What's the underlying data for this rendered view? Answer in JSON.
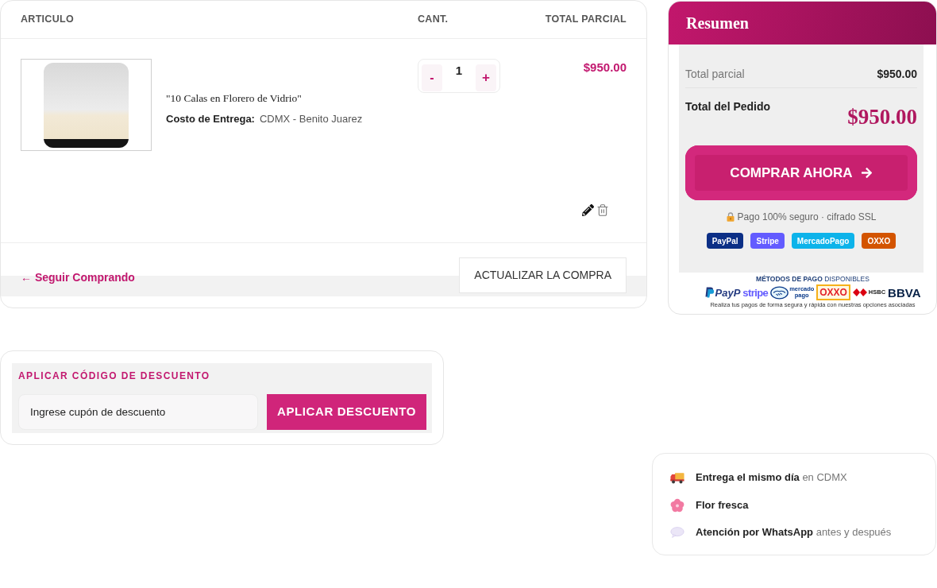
{
  "cart": {
    "columns": [
      "ARTICULO",
      "CANT.",
      "TOTAL PARCIAL"
    ],
    "items": [
      {
        "name": "\"10 Calas en Florero de Vidrio\"",
        "delivery_label": "Costo de Entrega:",
        "delivery_value": "CDMX - Benito Juarez",
        "decrement": "-",
        "quantity": "1",
        "increment": "+",
        "subtotal": "$950.00"
      }
    ],
    "continue_link": "← Seguir Comprando",
    "update_button": "ACTUALIZAR LA COMPRA"
  },
  "summary": {
    "title": "Resumen",
    "rows": [
      {
        "kind": "subtotal",
        "label": "Total parcial",
        "value": "$950.00"
      },
      {
        "kind": "total",
        "label": "Total del Pedido",
        "value": "$950.00"
      }
    ],
    "checkout_button": "COMPRAR AHORA",
    "secure_note": "Pago 100% seguro · cifrado SSL",
    "badges": [
      {
        "label": "PayPal",
        "color": "#0c2f86"
      },
      {
        "label": "Stripe",
        "color": "#635bff"
      },
      {
        "label": "MercadoPago",
        "color": "#0db3ea"
      },
      {
        "label": "OXXO",
        "color": "#d35400"
      }
    ],
    "payment_banner": {
      "title": "**MÉTODOS DE PAGO** DISPONIBLES",
      "logos": [
        {
          "kind": "paypal",
          "label": "PayP"
        },
        {
          "kind": "stripe",
          "label": "stripe"
        },
        {
          "kind": "mercadopago",
          "label": "mercado pago"
        },
        {
          "kind": "oxxo",
          "label": "OXXO"
        },
        {
          "kind": "hsbc",
          "label": "HSBC"
        },
        {
          "kind": "bbva",
          "label": "BBVA"
        }
      ],
      "caption": "Realiza tus pagos de forma segura y rápida con nuestras opciones asociadas"
    }
  },
  "discount": {
    "title": "APLICAR CÓDIGO DE DESCUENTO",
    "placeholder": "Ingrese cupón de descuento",
    "button": "APLICAR DESCUENTO"
  },
  "features": [
    {
      "kind": "delivery",
      "title": "Entrega el mismo día",
      "detail": "en CDMX"
    },
    {
      "kind": "flower",
      "title": "Flor fresca"
    },
    {
      "kind": "chat",
      "title": "Atención por WhatsApp",
      "detail": "antes y después"
    }
  ]
}
